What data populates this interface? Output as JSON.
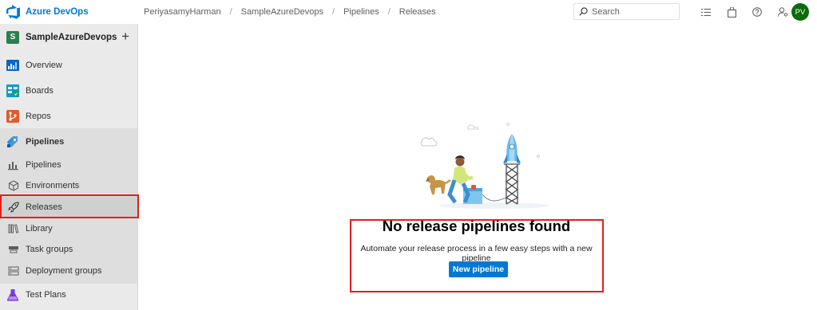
{
  "brand": {
    "name": "Azure DevOps",
    "icon": "azure-devops-logo"
  },
  "breadcrumb": [
    "PeriyasamyHarman",
    "SampleAzureDevops",
    "Pipelines",
    "Releases"
  ],
  "breadcrumb_separator": "/",
  "search": {
    "placeholder": "Search"
  },
  "top_icons": [
    "settings-list-icon",
    "marketplace-bag-icon",
    "help-icon",
    "user-settings-icon"
  ],
  "user": {
    "initials": "PV",
    "avatar_color": "#0b6a0b"
  },
  "project": {
    "initial": "S",
    "name": "SampleAzureDevops",
    "add_label": "+"
  },
  "sidebar": {
    "overview": "Overview",
    "boards": "Boards",
    "repos": "Repos",
    "pipelines": "Pipelines",
    "sub": {
      "pipelines": "Pipelines",
      "environments": "Environments",
      "releases": "Releases",
      "library": "Library",
      "task_groups": "Task groups",
      "deployment_groups": "Deployment groups"
    },
    "test_plans": "Test Plans"
  },
  "empty_state": {
    "title": "No release pipelines found",
    "description": "Automate your release process in a few easy steps with a new pipeline",
    "button": "New pipeline"
  },
  "colors": {
    "accent": "#0078d4",
    "highlight": "#e0201b",
    "sidebar_bg": "#eaeaea"
  }
}
